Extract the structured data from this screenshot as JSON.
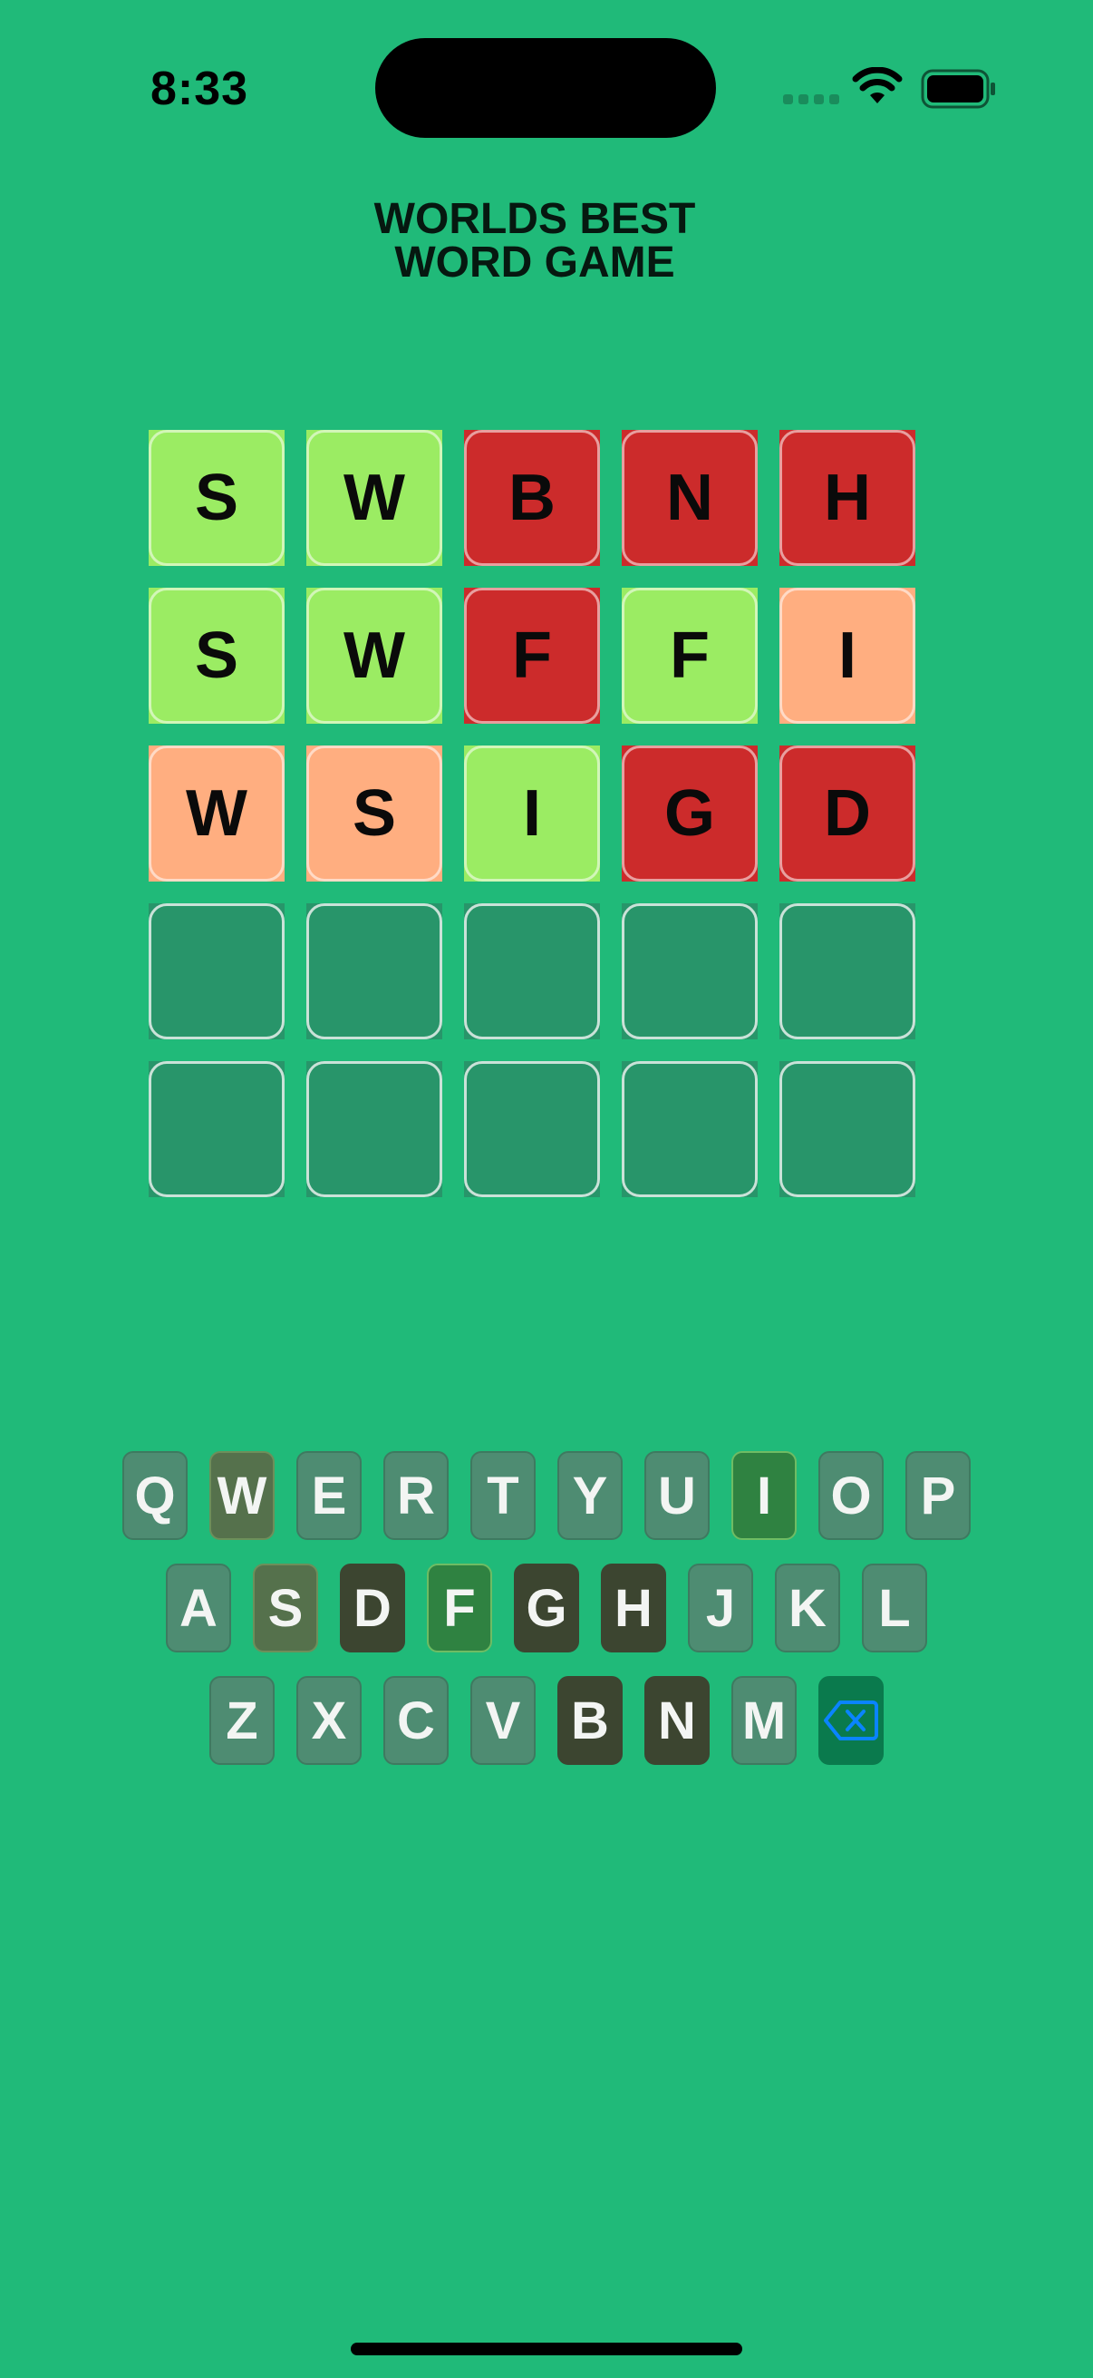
{
  "status_bar": {
    "time": "8:33"
  },
  "title": {
    "line1": "WORLDS BEST",
    "line2": "WORD GAME"
  },
  "board": [
    [
      {
        "letter": "S",
        "state": "green"
      },
      {
        "letter": "W",
        "state": "green"
      },
      {
        "letter": "B",
        "state": "red"
      },
      {
        "letter": "N",
        "state": "red"
      },
      {
        "letter": "H",
        "state": "red"
      }
    ],
    [
      {
        "letter": "S",
        "state": "green"
      },
      {
        "letter": "W",
        "state": "green"
      },
      {
        "letter": "F",
        "state": "red"
      },
      {
        "letter": "F",
        "state": "green"
      },
      {
        "letter": "I",
        "state": "orange"
      }
    ],
    [
      {
        "letter": "W",
        "state": "orange"
      },
      {
        "letter": "S",
        "state": "orange"
      },
      {
        "letter": "I",
        "state": "green"
      },
      {
        "letter": "G",
        "state": "red"
      },
      {
        "letter": "D",
        "state": "red"
      }
    ],
    [
      {
        "letter": "",
        "state": "empty"
      },
      {
        "letter": "",
        "state": "empty"
      },
      {
        "letter": "",
        "state": "empty"
      },
      {
        "letter": "",
        "state": "empty"
      },
      {
        "letter": "",
        "state": "empty"
      }
    ],
    [
      {
        "letter": "",
        "state": "empty"
      },
      {
        "letter": "",
        "state": "empty"
      },
      {
        "letter": "",
        "state": "empty"
      },
      {
        "letter": "",
        "state": "empty"
      },
      {
        "letter": "",
        "state": "empty"
      }
    ]
  ],
  "keyboard": {
    "rows": [
      [
        {
          "label": "Q",
          "state": "unused"
        },
        {
          "label": "W",
          "state": "partial"
        },
        {
          "label": "E",
          "state": "unused"
        },
        {
          "label": "R",
          "state": "unused"
        },
        {
          "label": "T",
          "state": "unused"
        },
        {
          "label": "Y",
          "state": "unused"
        },
        {
          "label": "U",
          "state": "unused"
        },
        {
          "label": "I",
          "state": "correct"
        },
        {
          "label": "O",
          "state": "unused"
        },
        {
          "label": "P",
          "state": "unused"
        }
      ],
      [
        {
          "label": "A",
          "state": "unused"
        },
        {
          "label": "S",
          "state": "partial"
        },
        {
          "label": "D",
          "state": "used"
        },
        {
          "label": "F",
          "state": "correct"
        },
        {
          "label": "G",
          "state": "used"
        },
        {
          "label": "H",
          "state": "used"
        },
        {
          "label": "J",
          "state": "unused"
        },
        {
          "label": "K",
          "state": "unused"
        },
        {
          "label": "L",
          "state": "unused"
        }
      ],
      [
        {
          "label": "Z",
          "state": "unused"
        },
        {
          "label": "X",
          "state": "unused"
        },
        {
          "label": "C",
          "state": "unused"
        },
        {
          "label": "V",
          "state": "unused"
        },
        {
          "label": "B",
          "state": "used"
        },
        {
          "label": "N",
          "state": "used"
        },
        {
          "label": "M",
          "state": "unused"
        },
        {
          "label": "",
          "state": "delete",
          "icon": "delete-backspace-icon"
        }
      ]
    ]
  },
  "colors": {
    "background": "#20ba79",
    "tile_green": "#9bec63",
    "tile_red": "#cc2b2b",
    "tile_orange": "#ffae80",
    "tile_empty": "#28956a",
    "key_unused": "#4e8c72",
    "key_used": "#3c4530",
    "key_partial": "#55714c",
    "key_correct": "#2f8241",
    "delete_icon": "#0a84ff"
  }
}
